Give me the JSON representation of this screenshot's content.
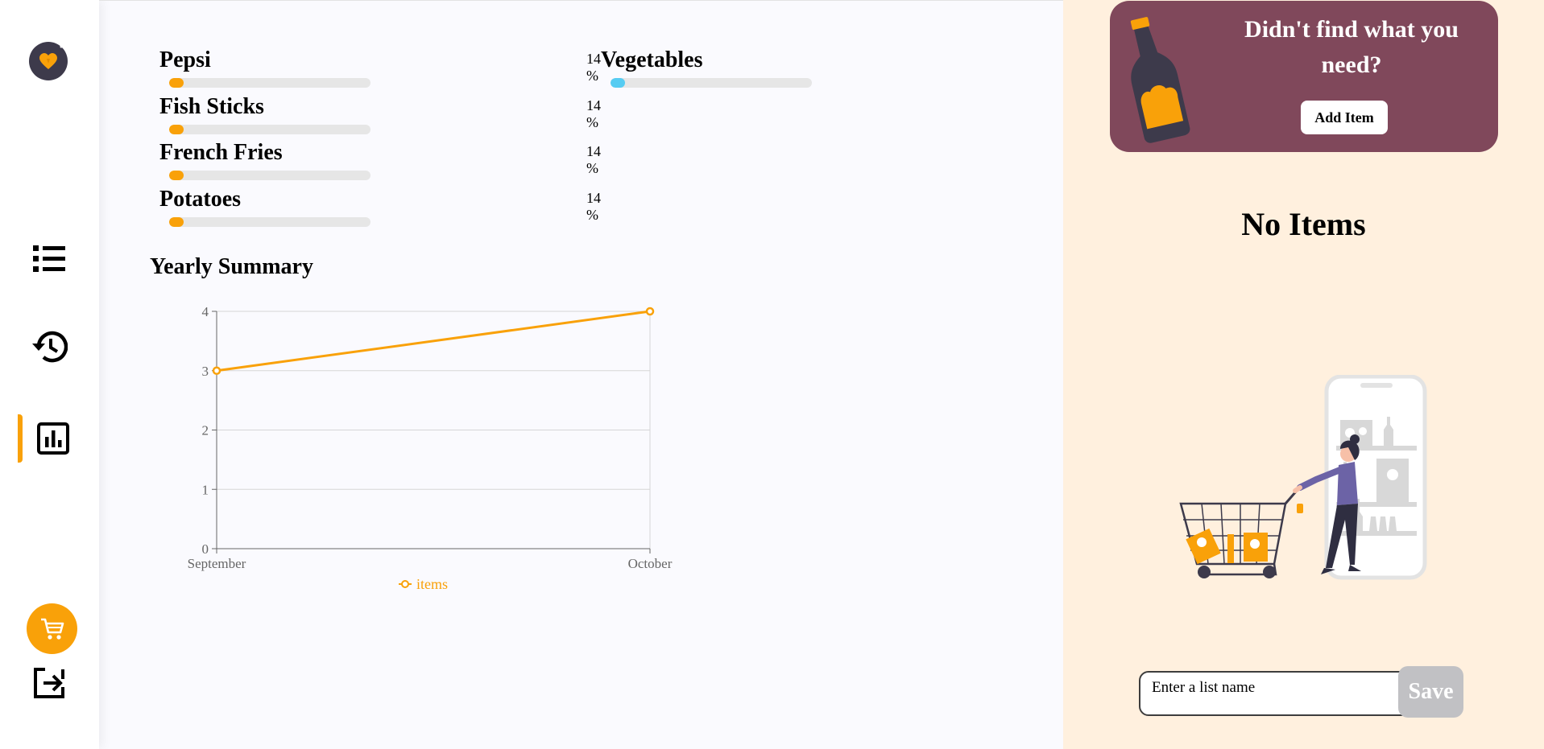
{
  "colors": {
    "accent": "#f9a109",
    "secondary_bar": "#56ccf2",
    "promo_bg": "#80485b",
    "right_bg": "#fff0de"
  },
  "sidebar": {
    "logo": "logo-icon",
    "items": [
      {
        "icon": "list-icon",
        "name": "items"
      },
      {
        "icon": "history-icon",
        "name": "history"
      },
      {
        "icon": "statistics-icon",
        "name": "statistics",
        "active": true
      }
    ],
    "cart_icon": "cart-icon",
    "logout_icon": "logout-icon"
  },
  "top_items": [
    {
      "name": "Pepsi",
      "percent_label": "14 %",
      "percent": 14
    },
    {
      "name": "Fish Sticks",
      "percent_label": "14 %",
      "percent": 14
    },
    {
      "name": "French Fries",
      "percent_label": "14 %",
      "percent": 14
    },
    {
      "name": "Potatoes",
      "percent_label": "14 %",
      "percent": 14
    }
  ],
  "top_categories": [
    {
      "name": "Vegetables",
      "percent_label": "14 %",
      "percent": 14
    }
  ],
  "summary": {
    "title": "Yearly Summary"
  },
  "chart_data": {
    "type": "line",
    "categories": [
      "September",
      "October"
    ],
    "series": [
      {
        "name": "items",
        "values": [
          3,
          4
        ],
        "color": "#f9a109"
      }
    ],
    "yticks": [
      "0",
      "1",
      "2",
      "3",
      "4"
    ],
    "ylim": [
      0,
      4
    ],
    "grid": true,
    "legend": "bottom"
  },
  "promo": {
    "text": "Didn't find what you need?",
    "button_label": "Add Item"
  },
  "list": {
    "empty_text": "No Items",
    "input_placeholder": "Enter a list name",
    "save_label": "Save"
  }
}
